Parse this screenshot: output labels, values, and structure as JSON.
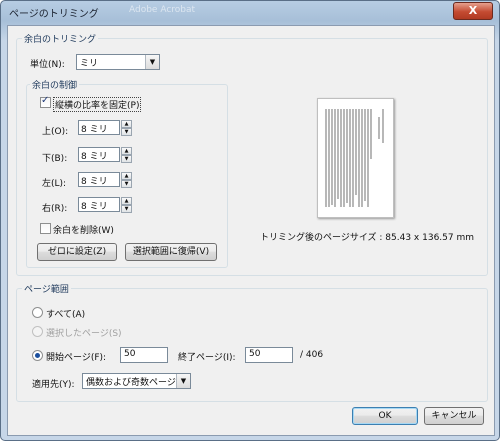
{
  "window": {
    "title": "ページのトリミング",
    "ghost_title": "Adobe Acrobat",
    "close_label": "X"
  },
  "margins": {
    "legend": "余白のトリミング",
    "unit_label": "単位(N):",
    "unit_value": "ミリ",
    "control_legend": "余白の制御",
    "keep_ratio_label": "縦横の比率を固定(P)",
    "keep_ratio_checked": true,
    "top_label": "上(O):",
    "top_value": "8 ミリ",
    "bottom_label": "下(B):",
    "bottom_value": "8 ミリ",
    "left_label": "左(L):",
    "left_value": "8 ミリ",
    "right_label": "右(R):",
    "right_value": "8 ミリ",
    "remove_white_label": "余白を削除(W)",
    "remove_white_checked": false,
    "zero_button": "ゼロに設定(Z)",
    "revert_button": "選択範囲に復帰(V)",
    "page_size_text": "トリミング後のページサイズ : 85.43 x 136.57 mm"
  },
  "page_range": {
    "legend": "ページ範囲",
    "all_label": "すべて(A)",
    "selected_label": "選択したページ(S)",
    "from_label": "開始ページ(F):",
    "from_value": "50",
    "to_label": "終了ページ(I):",
    "to_value": "50",
    "total": "/ 406",
    "apply_label": "適用先(Y):",
    "apply_value": "偶数および奇数ページ"
  },
  "buttons": {
    "ok": "OK",
    "cancel": "キャンセル"
  },
  "icons": {
    "dropdown": "chevron-down-icon",
    "spin_up": "arrow-up-icon",
    "spin_down": "arrow-down-icon"
  }
}
